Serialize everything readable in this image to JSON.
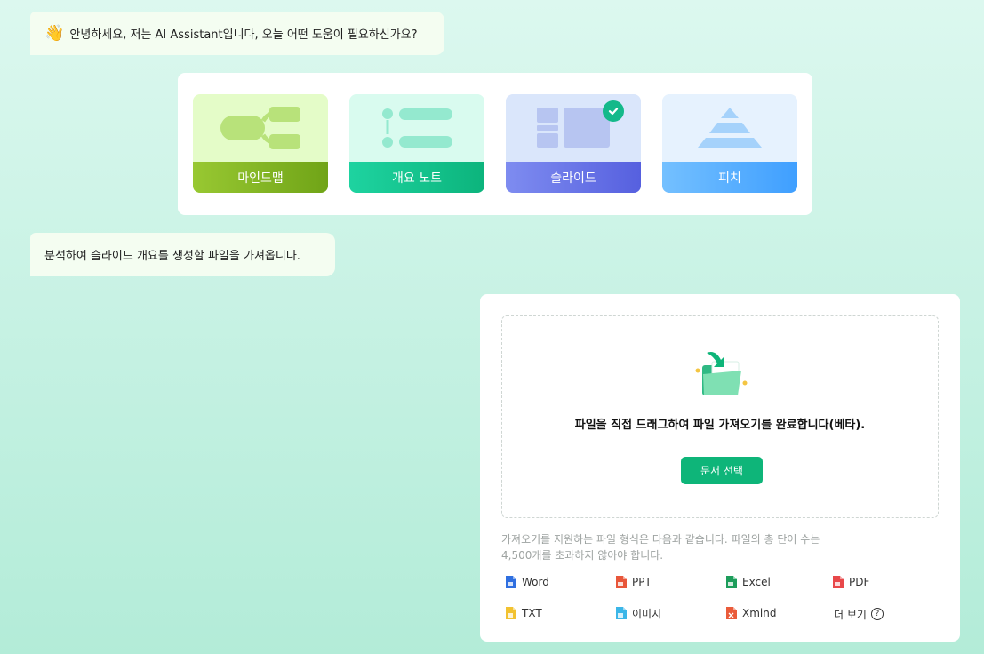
{
  "greeting": {
    "emoji": "👋",
    "text": "안녕하세요, 저는 AI Assistant입니다, 오늘 어떤 도움이 필요하신가요?"
  },
  "modes": {
    "selected": "slide",
    "items": [
      {
        "id": "mindmap",
        "label": "마인드맵",
        "icon": "mindmap-icon"
      },
      {
        "id": "outline",
        "label": "개요 노트",
        "icon": "outline-list-icon"
      },
      {
        "id": "slide",
        "label": "슬라이드",
        "icon": "slide-layout-icon"
      },
      {
        "id": "pitch",
        "label": "피치",
        "icon": "pyramid-icon"
      }
    ]
  },
  "prompt": {
    "text": "분석하여 슬라이드 개요를 생성할 파일을 가져옵니다."
  },
  "import": {
    "drop_text": "파일을 직접 드래그하여 파일 가져오기를 완료합니다(베타).",
    "select_button": "문서 선택",
    "support_line1": "가져오기를 지원하는 파일 형식은 다음과 같습니다. 파일의 총 단어 수는",
    "support_line2": "4,500개를 초과하지 않아야 합니다.",
    "formats": [
      {
        "label": "Word",
        "icon": "word-file-icon",
        "color": "#2f6fe0"
      },
      {
        "label": "PPT",
        "icon": "ppt-file-icon",
        "color": "#e8563a"
      },
      {
        "label": "Excel",
        "icon": "excel-file-icon",
        "color": "#1d9d5b"
      },
      {
        "label": "PDF",
        "icon": "pdf-file-icon",
        "color": "#e8484a"
      },
      {
        "label": "TXT",
        "icon": "txt-file-icon",
        "color": "#f2c230"
      },
      {
        "label": "이미지",
        "icon": "image-file-icon",
        "color": "#3bb6e8"
      },
      {
        "label": "Xmind",
        "icon": "xmind-file-icon",
        "color": "#ea5b3a"
      }
    ],
    "more_label": "더 보기",
    "help_glyph": "?"
  }
}
